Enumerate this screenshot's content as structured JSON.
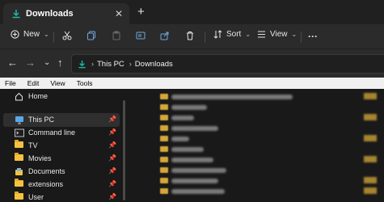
{
  "tab": {
    "title": "Downloads",
    "close_icon": "close-icon",
    "new_tab_icon": "plus-icon"
  },
  "toolbar": {
    "new_label": "New",
    "sort_label": "Sort",
    "view_label": "View",
    "more_label": "···"
  },
  "address": {
    "crumbs": [
      "This PC",
      "Downloads"
    ]
  },
  "menu": {
    "items": [
      "File",
      "Edit",
      "View",
      "Tools"
    ]
  },
  "sidebar": {
    "items": [
      {
        "label": "Home",
        "icon": "home-icon"
      },
      {
        "label": "This PC",
        "icon": "monitor-icon"
      },
      {
        "label": "Command line",
        "icon": "terminal-icon"
      },
      {
        "label": "TV",
        "icon": "folder-icon"
      },
      {
        "label": "Movies",
        "icon": "folder-icon"
      },
      {
        "label": "Documents",
        "icon": "documents-icon"
      },
      {
        "label": "extensions",
        "icon": "folder-icon"
      },
      {
        "label": "User",
        "icon": "folder-icon"
      }
    ]
  },
  "colors": {
    "accent": "#1fb9a4",
    "folder": "#f5c23d"
  }
}
